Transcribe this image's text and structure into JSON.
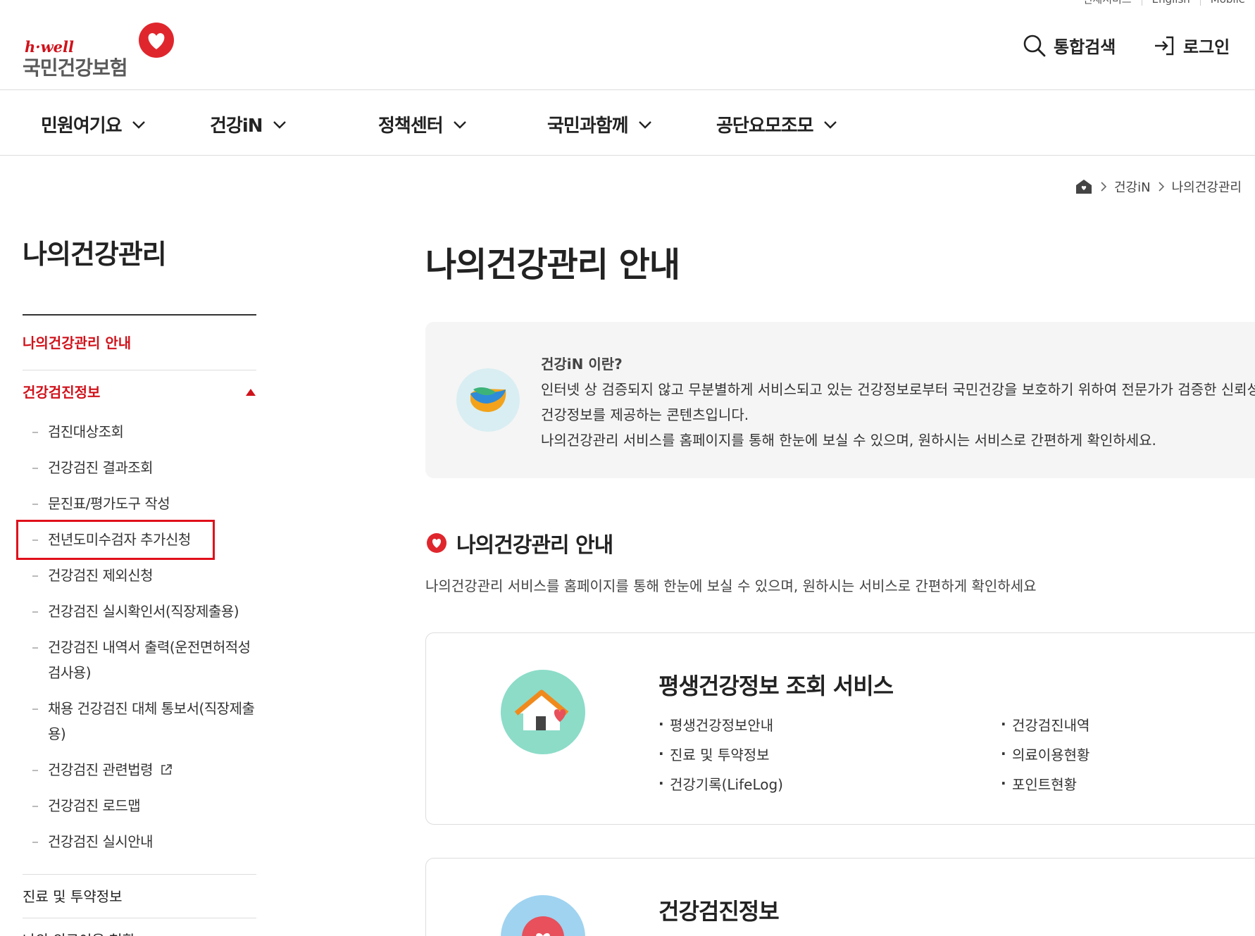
{
  "utility": [
    "전체서비스",
    "English",
    "Mobile"
  ],
  "logo": {
    "hwell": "h·well",
    "name": "국민건강보험"
  },
  "header": {
    "search_label": "통합검색",
    "login_label": "로그인"
  },
  "gnb": [
    {
      "label": "민원여기요"
    },
    {
      "label": "건강iN"
    },
    {
      "label": "정책센터"
    },
    {
      "label": "국민과함께"
    },
    {
      "label": "공단요모조모"
    }
  ],
  "breadcrumb": {
    "items": [
      "건강iN",
      "나의건강관리"
    ]
  },
  "sidebar": {
    "title": "나의건강관리",
    "top_item": "나의건강관리 안내",
    "group_label": "건강검진정보",
    "sub_items": [
      "검진대상조회",
      "건강검진 결과조회",
      "문진표/평가도구 작성",
      "전년도미수검자 추가신청",
      "건강검진 제외신청",
      "건강검진 실시확인서(직장제출용)",
      "건강검진 내역서 출력(운전면허적성검사용)",
      "채용 건강검진 대체 통보서(직장제출용)",
      "건강검진 관련법령",
      "건강검진 로드맵",
      "건강검진 실시안내"
    ],
    "bottom_items": [
      "진료 및 투약정보",
      "나의 의료이용 현황"
    ]
  },
  "main": {
    "title": "나의건강관리 안내",
    "info": {
      "question": "건강iN 이란?",
      "line1": "인터넷 상 검증되지 않고 무분별하게 서비스되고 있는 건강정보로부터 국민건강을 보호하기 위하여 전문가가 검증한 신뢰성 있는",
      "line2": "건강정보를 제공하는 콘텐츠입니다.",
      "line3": "나의건강관리 서비스를 홈페이지를 통해 한눈에 보실 수 있으며, 원하시는 서비스로 간편하게 확인하세요."
    },
    "section_title": "나의건강관리 안내",
    "section_desc": "나의건강관리 서비스를 홈페이지를 통해 한눈에 보실 수 있으며, 원하시는 서비스로 간편하게 확인하세요",
    "card1": {
      "title": "평생건강정보 조회 서비스",
      "col1": [
        "평생건강정보안내",
        "진료 및 투약정보",
        "건강기록(LifeLog)"
      ],
      "col2": [
        "건강검진내역",
        "의료이용현황",
        "포인트현황"
      ]
    },
    "card2": {
      "title": "건강검진정보"
    }
  },
  "colors": {
    "brand_red": "#d0121b",
    "highlight_box": "#e0101b",
    "info_bg": "#f5f5f5"
  }
}
